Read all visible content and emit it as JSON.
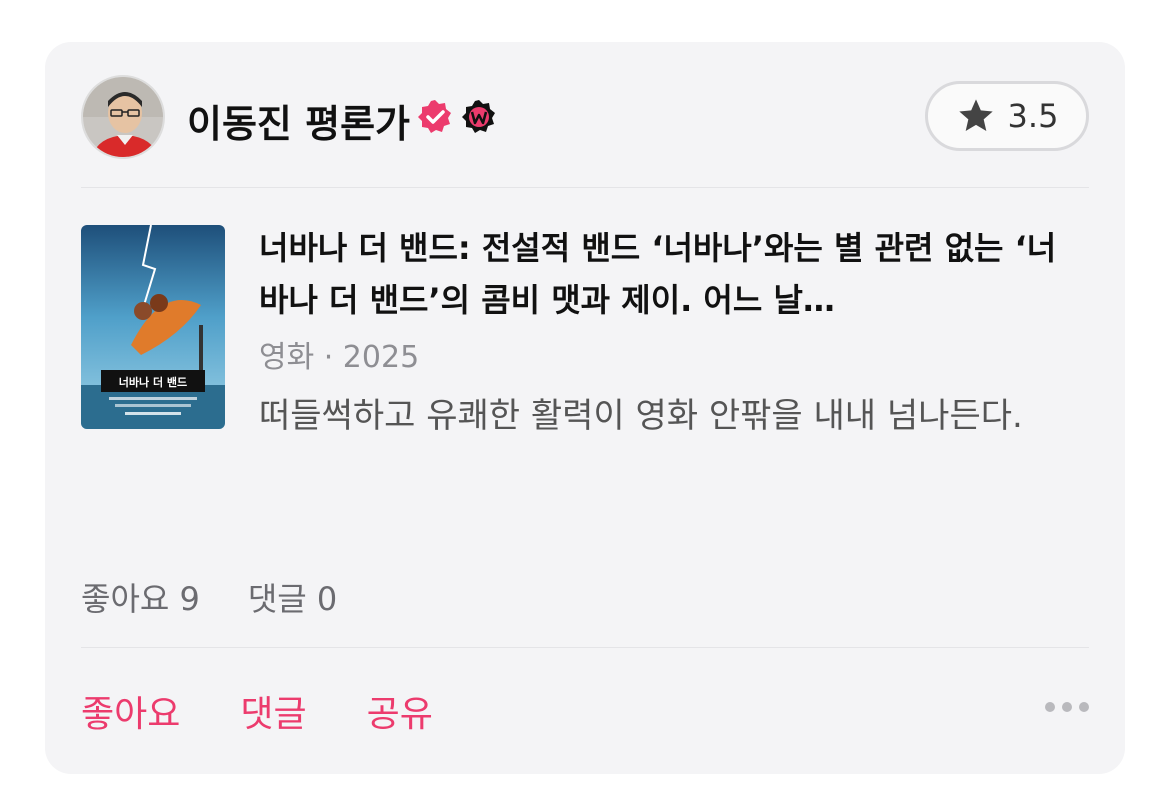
{
  "author": {
    "name": "이동진 평론가"
  },
  "rating": {
    "value": "3.5",
    "icon": "star-icon"
  },
  "movie": {
    "title": "너바나 더 밴드: 전설적 밴드 ‘너바나’와는 별 관련 없는 ‘너바나 더 밴드’의 콤비 맷과 제이. 어느 날…",
    "meta": "영화 · 2025",
    "poster_text": "너바나 더 밴드"
  },
  "review": {
    "text": "떠들썩하고 유쾌한 활력이 영화 안팎을 내내 넘나든다."
  },
  "stats": {
    "likes": "좋아요 9",
    "comments": "댓글 0"
  },
  "actions": {
    "like": "좋아요",
    "comment": "댓글",
    "share": "공유"
  },
  "colors": {
    "accent": "#ec3b6d",
    "card_bg": "#f4f4f6",
    "verified_badge": "#ec3b6d"
  }
}
